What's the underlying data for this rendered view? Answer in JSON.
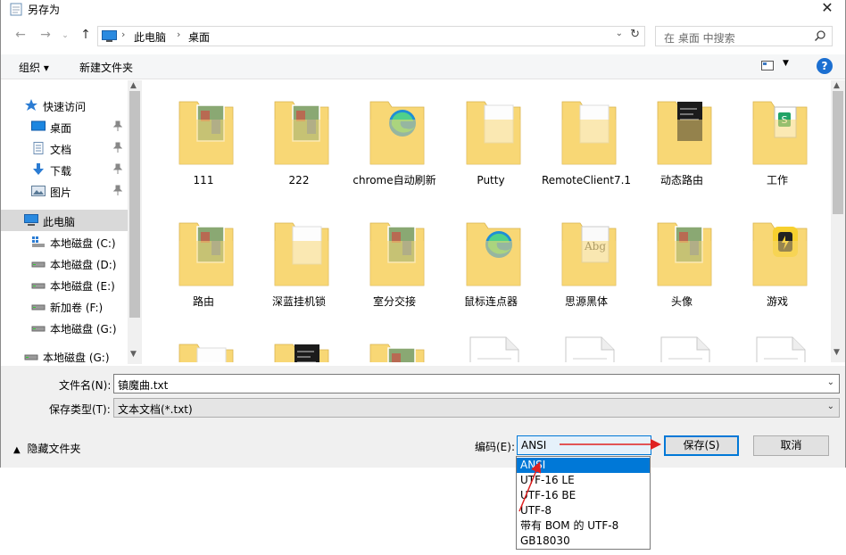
{
  "window": {
    "title": "另存为"
  },
  "address": {
    "crumbs": [
      "此电脑",
      "桌面"
    ]
  },
  "search": {
    "placeholder": "在 桌面 中搜索"
  },
  "toolbar": {
    "organize": "组织 ▾",
    "new_folder": "新建文件夹",
    "help": "?"
  },
  "nav": {
    "quick_access": "快速访问",
    "items": [
      {
        "label": "桌面",
        "pinned": true
      },
      {
        "label": "文档",
        "pinned": true
      },
      {
        "label": "下载",
        "pinned": true
      },
      {
        "label": "图片",
        "pinned": true
      }
    ],
    "this_pc": "此电脑",
    "drives": [
      "本地磁盘 (C:)",
      "本地磁盘 (D:)",
      "本地磁盘 (E:)",
      "新加卷 (F:)",
      "本地磁盘 (G:)"
    ],
    "extra_drive": "本地磁盘 (G:)"
  },
  "files": [
    {
      "name": "111",
      "icon": "folder-photo-icon"
    },
    {
      "name": "222",
      "icon": "folder-photo-icon"
    },
    {
      "name": "chrome自动刷新",
      "icon": "folder-edge-icon"
    },
    {
      "name": "Putty",
      "icon": "folder-icon"
    },
    {
      "name": "RemoteClient7.1",
      "icon": "folder-icon"
    },
    {
      "name": "动态路由",
      "icon": "folder-terminal-icon"
    },
    {
      "name": "工作",
      "icon": "folder-excel-icon"
    },
    {
      "name": "路由",
      "icon": "folder-photo-icon"
    },
    {
      "name": "深蓝挂机锁",
      "icon": "folder-icon"
    },
    {
      "name": "室分交接",
      "icon": "folder-photo-icon"
    },
    {
      "name": "鼠标连点器",
      "icon": "folder-edge-icon"
    },
    {
      "name": "思源黑体",
      "icon": "folder-font-icon"
    },
    {
      "name": "头像",
      "icon": "folder-photo-icon"
    },
    {
      "name": "游戏",
      "icon": "folder-app-icon"
    }
  ],
  "fields": {
    "filename_label": "文件名(N):",
    "filename_value": "镇魔曲.txt",
    "filetype_label": "保存类型(T):",
    "filetype_value": "文本文档(*.txt)"
  },
  "footer": {
    "hide_folders": "隐藏文件夹",
    "encoding_label": "编码(E):",
    "encoding_value": "ANSI",
    "save": "保存(S)",
    "cancel": "取消"
  },
  "encoding_options": [
    "ANSI",
    "UTF-16 LE",
    "UTF-16 BE",
    "UTF-8",
    "带有 BOM 的 UTF-8",
    "GB18030"
  ],
  "colors": {
    "accent": "#0078d7",
    "folder": "#f8d775",
    "annotation": "#e02020"
  }
}
